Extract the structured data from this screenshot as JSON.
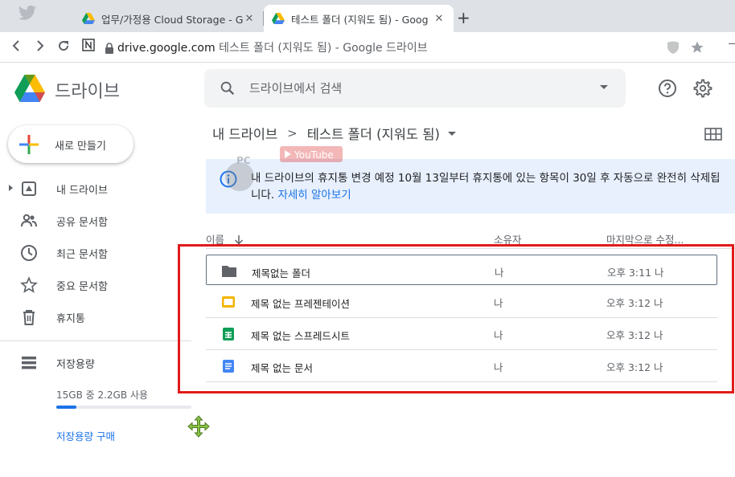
{
  "browser": {
    "tabs": [
      {
        "title": "업무/가정용 Cloud Storage - Go",
        "close": "✕"
      },
      {
        "title": "테스트 폴더 (지워도 됨) - Goog",
        "close": "✕"
      }
    ],
    "new_tab": "+",
    "url_domain": "drive.google.com",
    "url_rest": "테스트 폴더 (지워도 됨) - Google 드라이브"
  },
  "header": {
    "app_name": "드라이브",
    "search_placeholder": "드라이브에서 검색"
  },
  "sidebar": {
    "new_button": "새로 만들기",
    "items": [
      {
        "label": "내 드라이브",
        "icon": "my-drive-icon"
      },
      {
        "label": "공유 문서함",
        "icon": "shared-people-icon"
      },
      {
        "label": "최근 문서함",
        "icon": "clock-icon"
      },
      {
        "label": "중요 문서함",
        "icon": "star-icon"
      },
      {
        "label": "휴지통",
        "icon": "trash-icon"
      },
      {
        "label": "저장용량",
        "icon": "storage-icon"
      }
    ],
    "storage_text": "15GB 중 2.2GB 사용",
    "storage_fraction": 0.147,
    "buy_storage": "저장용량 구매"
  },
  "main": {
    "breadcrumb": [
      "내 드라이브",
      "테스트 폴더 (지워도 됨)"
    ],
    "breadcrumb_sep": ">",
    "notice_text": "내 드라이브의 휴지통 변경 예정 10월 13일부터 휴지통에 있는 항목이 30일 후 자동으로 완전히 삭제됩니다. ",
    "notice_link": "자세히 알아보기",
    "columns": {
      "name": "이름",
      "owner": "소유자",
      "modified": "마지막으로 수정..."
    },
    "files": [
      {
        "name": "제목없는 폴더",
        "owner": "나",
        "modified": "오후 3:11 나",
        "type": "folder"
      },
      {
        "name": "제목 없는 프레젠테이션",
        "owner": "나",
        "modified": "오후 3:12 나",
        "type": "slides"
      },
      {
        "name": "제목 없는 스프레드시트",
        "owner": "나",
        "modified": "오후 3:12 나",
        "type": "sheets"
      },
      {
        "name": "제목 없는 문서",
        "owner": "나",
        "modified": "오후 3:12 나",
        "type": "docs"
      }
    ]
  },
  "watermark": {
    "text1": "PC",
    "text2": "YouTube"
  },
  "colors": {
    "accent": "#1a73e8",
    "highlight": "#e01b1b",
    "notice_bg": "#e8f0fe"
  }
}
